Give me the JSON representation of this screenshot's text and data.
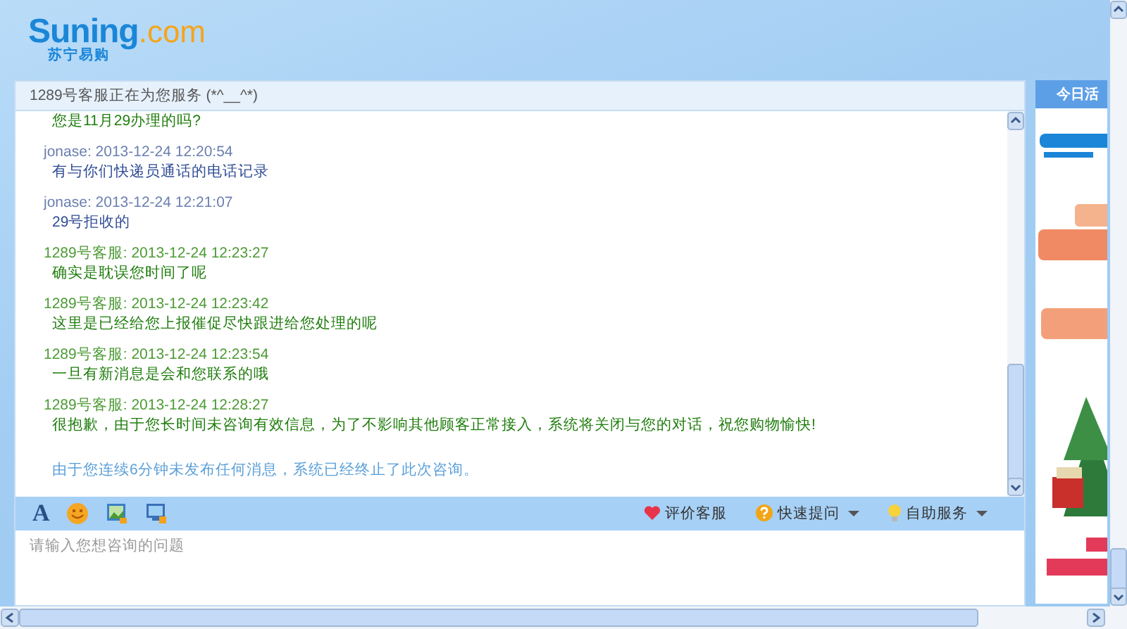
{
  "logo": {
    "name": "Suning",
    "suffix": ".com",
    "tagline": "苏宁易购"
  },
  "chat": {
    "title": "1289号客服正在为您服务 (*^__^*)",
    "messages": [
      {
        "kind": "agent",
        "text": "您是11月29办理的吗?"
      },
      {
        "kind": "user",
        "header": "jonase:  2013-12-24 12:20:54",
        "text": "有与你们快递员通话的电话记录"
      },
      {
        "kind": "user",
        "header": "jonase:  2013-12-24 12:21:07",
        "text": "29号拒收的"
      },
      {
        "kind": "agent",
        "header": "1289号客服:  2013-12-24 12:23:27",
        "text": "确实是耽误您时间了呢"
      },
      {
        "kind": "agent",
        "header": "1289号客服:  2013-12-24 12:23:42",
        "text": "这里是已经给您上报催促尽快跟进给您处理的呢"
      },
      {
        "kind": "agent",
        "header": "1289号客服:  2013-12-24 12:23:54",
        "text": "一旦有新消息是会和您联系的哦"
      },
      {
        "kind": "agent",
        "header": "1289号客服:  2013-12-24 12:28:27",
        "text": "很抱歉，由于您长时间未咨询有效信息，为了不影响其他顾客正常接入，系统将关闭与您的对话，祝您购物愉快!"
      },
      {
        "kind": "system",
        "text": "由于您连续6分钟未发布任何消息，系统已经终止了此次咨询。"
      }
    ],
    "toolbar": {
      "font_glyph": "A",
      "actions": [
        {
          "kind": "heart",
          "label": "评价客服",
          "dropdown": false
        },
        {
          "kind": "question",
          "label": "快速提问",
          "dropdown": true
        },
        {
          "kind": "bulb",
          "label": "自助服务",
          "dropdown": true
        }
      ]
    },
    "input": {
      "placeholder": "请输入您想咨询的问题"
    }
  },
  "side": {
    "tab": "今日活"
  }
}
